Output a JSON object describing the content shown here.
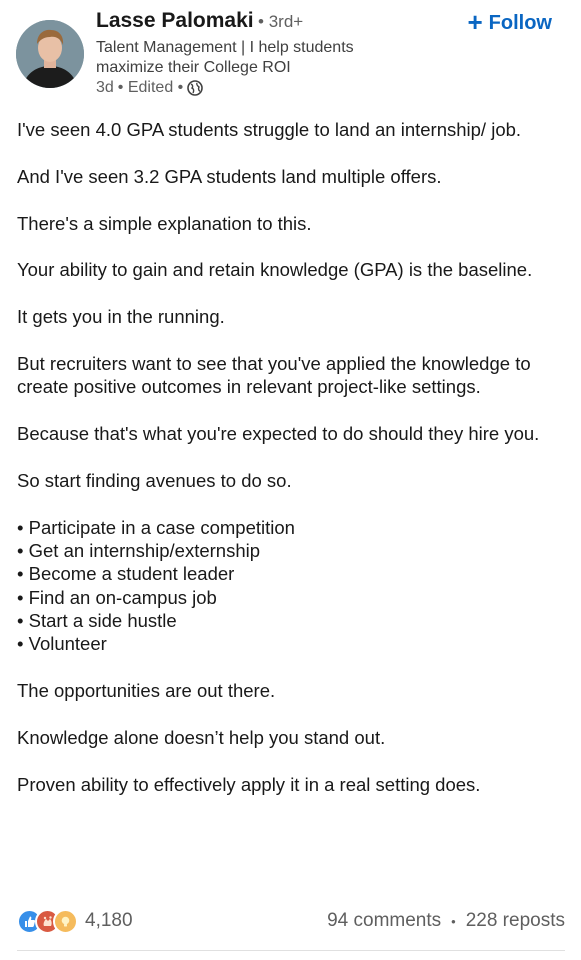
{
  "author": {
    "name": "Lasse Palomaki",
    "degree": "• 3rd+",
    "headline": "Talent Management | I help students maximize their College ROI",
    "time": "3d",
    "edited": "• Edited •",
    "visibility_icon": "globe-icon"
  },
  "follow_label": "Follow",
  "post": {
    "paragraphs": [
      "I've seen 4.0 GPA students struggle to land an internship/ job.",
      "And I've seen 3.2 GPA students land multiple offers.",
      "There's a simple explanation to this.",
      "Your ability to gain and retain knowledge (GPA) is the baseline.",
      "It gets you in the running.",
      "But recruiters want to see that you've applied the knowledge to create positive outcomes in relevant project-like settings.",
      "Because that's what you're expected to do should they hire you.",
      "So start finding avenues to do so."
    ],
    "bullets": [
      "Participate in a case competition",
      "Get an internship/externship",
      "Become a student leader",
      "Find an on-campus job",
      "Start a side hustle",
      "Volunteer"
    ],
    "closing": [
      "The opportunities are out there.",
      "Knowledge alone doesn’t help you stand out.",
      "Proven ability to effectively apply it in a real setting does."
    ]
  },
  "social": {
    "reaction_icons": [
      "like-icon",
      "celebrate-icon",
      "insightful-icon"
    ],
    "reactions_count": "4,180",
    "comments": "94 comments",
    "separator": "•",
    "reposts": "228 reposts"
  },
  "colors": {
    "accent": "#0a66c2",
    "text": "#191919",
    "muted": "#5f5f5f"
  }
}
